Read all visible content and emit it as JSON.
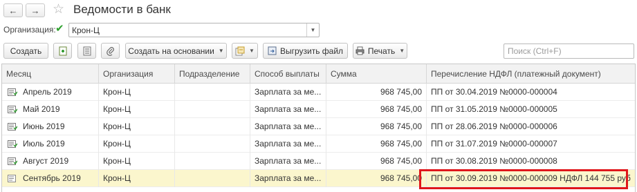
{
  "window": {
    "title": "Ведомости в банк"
  },
  "nav": {
    "back_label": "←",
    "forward_label": "→",
    "star_label": "☆"
  },
  "filter": {
    "org_label": "Организация:",
    "org_value": "Крон-Ц",
    "check_glyph": "✔"
  },
  "toolbar": {
    "create_label": "Создать",
    "create_based_label": "Создать на основании",
    "export_file_label": "Выгрузить файл",
    "print_label": "Печать"
  },
  "search": {
    "placeholder": "Поиск (Ctrl+F)"
  },
  "table": {
    "headers": [
      "Месяц",
      "Организация",
      "Подразделение",
      "Способ выплаты",
      "Сумма",
      "Перечисление НДФЛ (платежный документ)"
    ],
    "rows": [
      {
        "month": "Апрель 2019",
        "org": "Крон-Ц",
        "division": "",
        "method": "Зарплата за ме...",
        "sum": "968 745,00",
        "ndfl": "ПП от 30.04.2019 №0000-000004"
      },
      {
        "month": "Май 2019",
        "org": "Крон-Ц",
        "division": "",
        "method": "Зарплата за ме...",
        "sum": "968 745,00",
        "ndfl": "ПП от 31.05.2019 №0000-000005"
      },
      {
        "month": "Июнь 2019",
        "org": "Крон-Ц",
        "division": "",
        "method": "Зарплата за ме...",
        "sum": "968 745,00",
        "ndfl": "ПП от 28.06.2019 №0000-000006"
      },
      {
        "month": "Июль 2019",
        "org": "Крон-Ц",
        "division": "",
        "method": "Зарплата за ме...",
        "sum": "968 745,00",
        "ndfl": "ПП от 31.07.2019 №0000-000007"
      },
      {
        "month": "Август 2019",
        "org": "Крон-Ц",
        "division": "",
        "method": "Зарплата за ме...",
        "sum": "968 745,00",
        "ndfl": "ПП от 30.08.2019 №0000-000008"
      },
      {
        "month": "Сентябрь 2019",
        "org": "Крон-Ц",
        "division": "",
        "method": "Зарплата за ме...",
        "sum": "968 745,00",
        "ndfl": "ПП от 30.09.2019 №0000-000009 НДФЛ 144 755 руб",
        "selected": true
      }
    ]
  },
  "colors": {
    "selected_row": "#fbf6cd",
    "highlight_border": "#e0161b",
    "check": "#2ca02c"
  }
}
